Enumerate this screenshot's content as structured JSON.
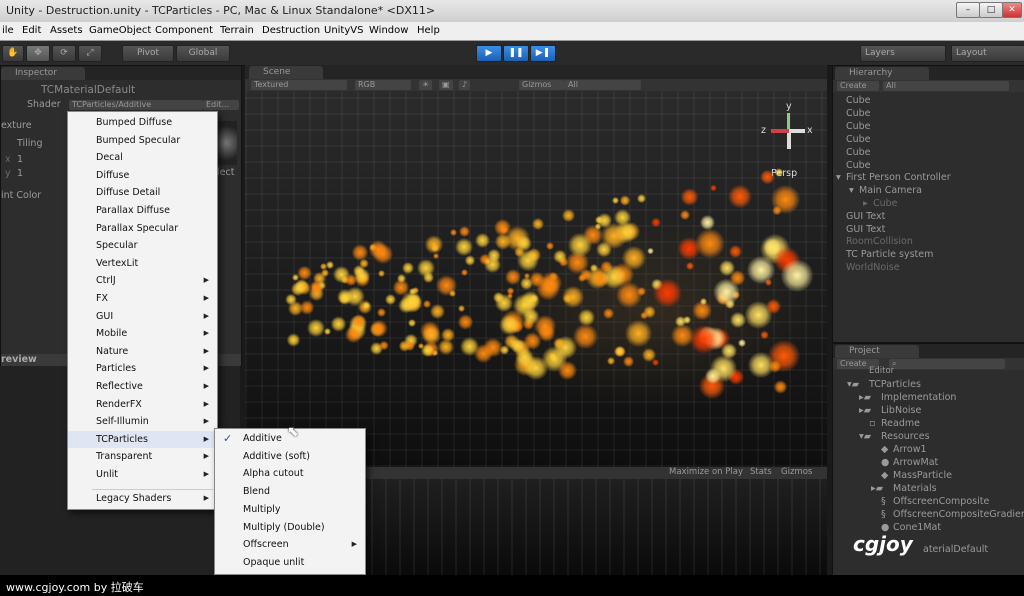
{
  "window": {
    "title": "Unity - Destruction.unity - TCParticles - PC, Mac & Linux Standalone* <DX11>",
    "min": "–",
    "max": "□",
    "close": "✕"
  },
  "menubar": [
    "ile",
    "Edit",
    "Assets",
    "GameObject",
    "Component",
    "Terrain",
    "Destruction",
    "UnityVS",
    "Window",
    "Help"
  ],
  "toolbar": {
    "pivot": "Pivot",
    "global": "Global",
    "layers": "Layers",
    "layout": "Layout"
  },
  "inspector": {
    "tab": "Inspector",
    "material_name": "TCMaterialDefault",
    "shader_label": "Shader",
    "shader_value": "TCParticles/Additive",
    "edit_label": "Edit...",
    "texture_label": "exture",
    "tiling_label": "Tiling",
    "x_label": "x",
    "y_label": "y",
    "tiling_x": "1",
    "tiling_y": "1",
    "select_label": "lect",
    "tint_label": "int Color",
    "preview_label": "review"
  },
  "scene": {
    "tab": "Scene",
    "shading": "Textured",
    "render_mode": "RGB",
    "gizmos": "Gizmos",
    "search": "All",
    "persp": "Persp",
    "axis_x": "x",
    "axis_y": "y",
    "axis_z": "z"
  },
  "game": {
    "maximize": "Maximize on Play",
    "stats": "Stats",
    "gizmos": "Gizmos"
  },
  "hierarchy": {
    "tab": "Hierarchy",
    "create": "Create",
    "search": "All",
    "items": [
      "Cube",
      "Cube",
      "Cube",
      "Cube",
      "Cube",
      "Cube",
      "First Person Controller",
      "Main Camera",
      "Cube",
      "GUI Text",
      "GUI Text",
      "RoomCollision",
      "TC Particle system",
      "WorldNoise"
    ]
  },
  "project": {
    "tab": "Project",
    "create": "Create",
    "items": [
      "Editor",
      "TCParticles",
      "Implementation",
      "LibNoise",
      "Readme",
      "Resources",
      "Arrow1",
      "ArrowMat",
      "MassParticle",
      "Materials",
      "OffscreenComposite",
      "OffscreenCompositeGradient",
      "Cone1Mat",
      "aterialDefault"
    ]
  },
  "shader_menu": {
    "items": [
      {
        "label": "Bumped Diffuse",
        "submenu": false
      },
      {
        "label": "Bumped Specular",
        "submenu": false
      },
      {
        "label": "Decal",
        "submenu": false
      },
      {
        "label": "Diffuse",
        "submenu": false
      },
      {
        "label": "Diffuse Detail",
        "submenu": false
      },
      {
        "label": "Parallax Diffuse",
        "submenu": false
      },
      {
        "label": "Parallax Specular",
        "submenu": false
      },
      {
        "label": "Specular",
        "submenu": false
      },
      {
        "label": "VertexLit",
        "submenu": false
      },
      {
        "label": "CtrlJ",
        "submenu": true
      },
      {
        "label": "FX",
        "submenu": true
      },
      {
        "label": "GUI",
        "submenu": true
      },
      {
        "label": "Mobile",
        "submenu": true
      },
      {
        "label": "Nature",
        "submenu": true
      },
      {
        "label": "Particles",
        "submenu": true
      },
      {
        "label": "Reflective",
        "submenu": true
      },
      {
        "label": "RenderFX",
        "submenu": true
      },
      {
        "label": "Self-Illumin",
        "submenu": true
      },
      {
        "label": "TCParticles",
        "submenu": true
      },
      {
        "label": "Transparent",
        "submenu": true
      },
      {
        "label": "Unlit",
        "submenu": true
      }
    ],
    "legacy": "Legacy Shaders",
    "arrow": "▶"
  },
  "tc_submenu": {
    "items": [
      {
        "label": "Additive",
        "checked": true,
        "submenu": false
      },
      {
        "label": "Additive (soft)",
        "checked": false,
        "submenu": false
      },
      {
        "label": "Alpha cutout",
        "checked": false,
        "submenu": false
      },
      {
        "label": "Blend",
        "checked": false,
        "submenu": false
      },
      {
        "label": "Multiply",
        "checked": false,
        "submenu": false
      },
      {
        "label": "Multiply (Double)",
        "checked": false,
        "submenu": false
      },
      {
        "label": "Offscreen",
        "checked": false,
        "submenu": true
      },
      {
        "label": "Opaque unlit",
        "checked": false,
        "submenu": false
      }
    ],
    "check": "✓"
  },
  "footer": {
    "watermark": "www.cgjoy.com by 拉破车",
    "logo": "cgjoy"
  },
  "colors": {
    "play": "#2f7fd6",
    "panel": "#2d2d2d",
    "menu": "#f3f3f3"
  }
}
